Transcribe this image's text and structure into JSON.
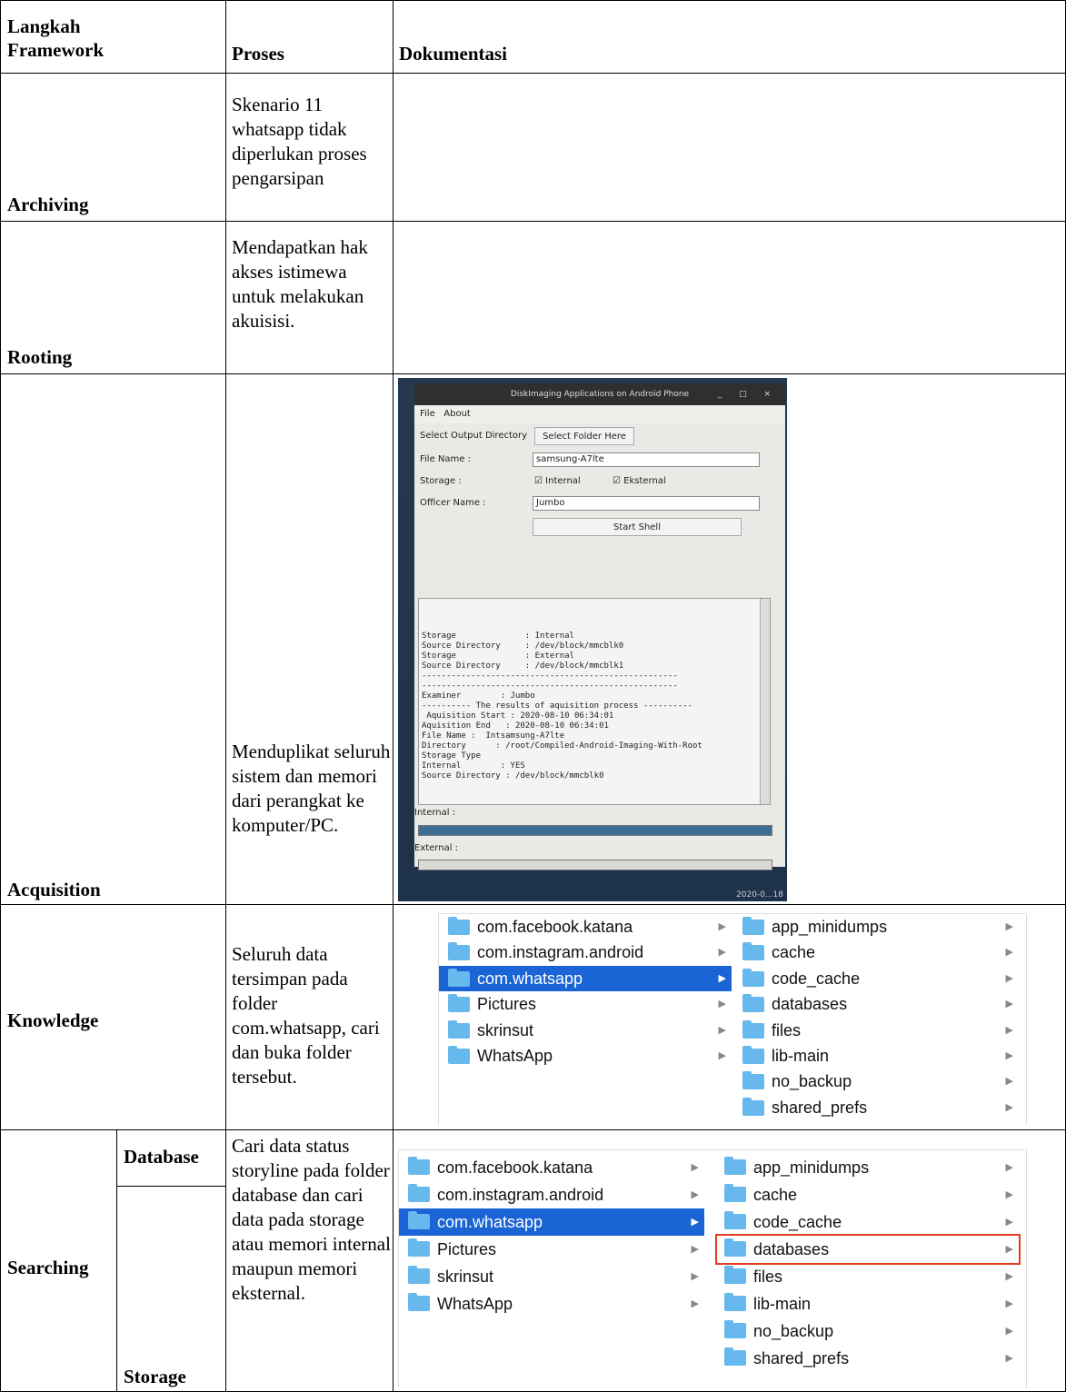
{
  "table": {
    "headers": {
      "step": "Langkah Framework",
      "process": "Proses",
      "documentation": "Dokumentasi"
    },
    "rows": [
      {
        "step": "Archiving",
        "process": "Skenario 11 whatsapp tidak diperlukan proses pengarsipan"
      },
      {
        "step": "Rooting",
        "process": "Mendapatkan hak akses istimewa untuk melakukan akuisisi."
      },
      {
        "step": "Acquisition",
        "process": "Menduplikat seluruh sistem dan memori dari perangkat ke komputer/PC."
      },
      {
        "step": "Knowledge",
        "process": "Seluruh data tersimpan pada folder com.whatsapp, cari dan buka folder tersebut."
      },
      {
        "step": "Searching",
        "sub": [
          "Database",
          "Storage"
        ],
        "process": "Cari data status storyline pada folder database dan cari data pada storage atau memori internal maupun memori eksternal."
      }
    ]
  },
  "app": {
    "title": "DiskImaging Applications on Android Phone",
    "window_controls": "_ □ ×",
    "menu": [
      "File",
      "About"
    ],
    "select_output_label": "Select Output Directory",
    "select_folder_button": "Select Folder Here",
    "file_name_label": "File Name :",
    "file_name_value": "samsung-A7lte",
    "storage_label": "Storage :",
    "internal_check": "Internal",
    "external_check": "Eksternal",
    "officer_label": "Officer Name :",
    "officer_value": "Jumbo",
    "start_shell_button": "Start Shell",
    "console_lines": [
      "Storage              : Internal",
      "Source Directory     : /dev/block/mmcblk0",
      "Storage              : External",
      "Source Directory     : /dev/block/mmcblk1",
      "----------------------------------------------------",
      "",
      "----------------------------------------------------",
      "Examiner        : Jumbo",
      "---------- The results of aquisition process ----------",
      " Aquisition Start : 2020-08-10 06:34:01",
      "Aquisition End   : 2020-08-10 06:34:01",
      "File Name :  Intsamsung-A7lte",
      "Directory      : /root/Compiled-Android-Imaging-With-Root",
      "",
      "Storage Type",
      "Internal        : YES",
      "Source Directory : /dev/block/mmcblk0"
    ],
    "internal_progress_label": "Internal :",
    "internal_progress": 1.0,
    "external_progress_label": "External :",
    "external_progress": 0.0,
    "corner_text": "2020-0...18"
  },
  "finder_left": [
    "com.facebook.katana",
    "com.instagram.android",
    "com.whatsapp",
    "Pictures",
    "skrinsut",
    "WhatsApp"
  ],
  "finder_right": [
    "app_minidumps",
    "cache",
    "code_cache",
    "databases",
    "files",
    "lib-main",
    "no_backup",
    "shared_prefs"
  ],
  "selected_left": "com.whatsapp",
  "highlighted_right": "databases",
  "colors": {
    "selection": "#1a64d6",
    "folder": "#67b8ec",
    "highlight_box": "#e13c1e"
  }
}
